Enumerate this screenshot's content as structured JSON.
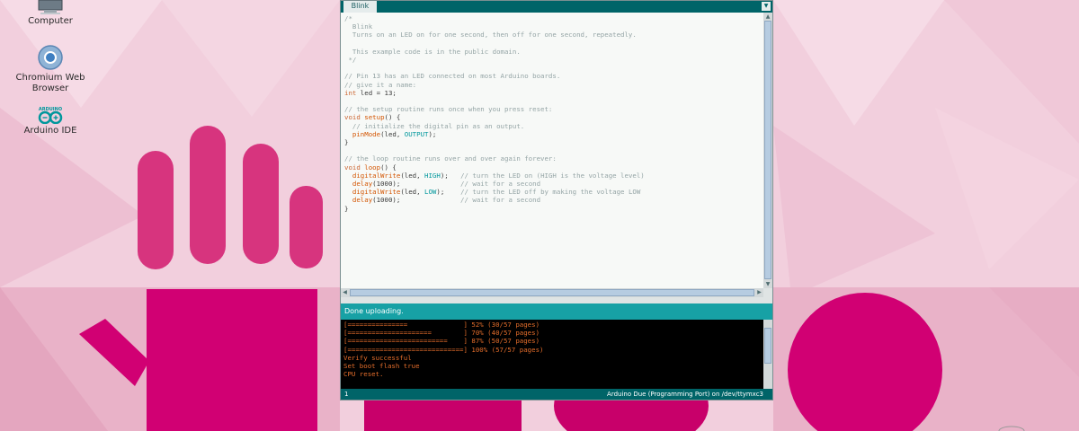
{
  "desktop": {
    "icons": [
      {
        "name": "computer",
        "label": "Computer",
        "icon": "computer-icon"
      },
      {
        "name": "chromium",
        "label": "Chromium Web Browser",
        "icon": "chromium-icon"
      },
      {
        "name": "arduino",
        "label": "Arduino IDE",
        "icon": "arduino-icon",
        "logo_text": "ARDUINO"
      }
    ],
    "colors": {
      "background": "#f2cfdd",
      "accent": "#d10073"
    }
  },
  "ide": {
    "tab": {
      "label": "Blink"
    },
    "code_lines": [
      "/*",
      "  Blink",
      "  Turns on an LED on for one second, then off for one second, repeatedly.",
      "",
      "  This example code is in the public domain.",
      " */",
      "",
      "// Pin 13 has an LED connected on most Arduino boards.",
      "// give it a name:",
      "int led = 13;",
      "",
      "// the setup routine runs once when you press reset:",
      "void setup() {",
      "  // initialize the digital pin as an output.",
      "  pinMode(led, OUTPUT);",
      "}",
      "",
      "// the loop routine runs over and over again forever:",
      "void loop() {",
      "  digitalWrite(led, HIGH);   // turn the LED on (HIGH is the voltage level)",
      "  delay(1000);               // wait for a second",
      "  digitalWrite(led, LOW);    // turn the LED off by making the voltage LOW",
      "  delay(1000);               // wait for a second",
      "}"
    ],
    "status": "Done uploading.",
    "console_lines": [
      "[===============              ] 52% (30/57 pages)",
      "[=====================        ] 70% (40/57 pages)",
      "[=========================    ] 87% (50/57 pages)",
      "[=============================] 100% (57/57 pages)",
      "Verify successful",
      "Set boot flash true",
      "CPU reset."
    ],
    "footer": {
      "line": "1",
      "board": "Arduino Due (Programming Port) on /dev/ttymxc3"
    },
    "colors": {
      "teal_dark": "#006468",
      "teal_status": "#17a1a5",
      "console_text": "#e36d2b"
    }
  }
}
